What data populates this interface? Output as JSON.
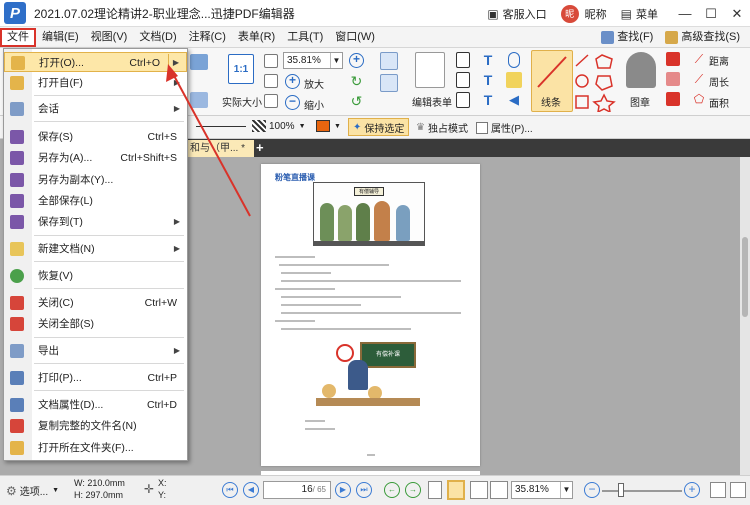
{
  "titlebar": {
    "logo_letter": "P",
    "title": "2021.07.02理论精讲2-职业理念...迅捷PDF编辑器",
    "feedback": "客服入口",
    "avatar_text": "昵",
    "nickname": "昵称",
    "menu": "菜单",
    "minimize": "—",
    "maximize": "☐",
    "close": "✕"
  },
  "menubar": {
    "items": [
      "文件",
      "编辑(E)",
      "视图(V)",
      "文档(D)",
      "注释(C)",
      "表单(R)",
      "工具(T)",
      "窗口(W)"
    ],
    "find": "查找(F)",
    "advanced_find": "高级查找(S)"
  },
  "ribbon": {
    "actual_size_glyph": "1:1",
    "actual_size": "实际大小",
    "zoom_value": "35.81%",
    "zoom_in": "放大",
    "zoom_out": "缩小",
    "edit_form": "编辑表单",
    "line": "线条",
    "stamp": "图章",
    "distance": "距离",
    "perimeter": "周长",
    "area": "面积"
  },
  "toolbar2": {
    "zoom": "100%",
    "keep_selected": "保持选定",
    "exclusive_mode": "独占模式",
    "properties": "属性(P)..."
  },
  "tabbar": {
    "tab_label": "和与（甲... *",
    "plus": "+"
  },
  "page": {
    "logo": "粉笔直播课",
    "sign1": "有偿辅导",
    "sign2": "有偿补课"
  },
  "file_menu": {
    "items": [
      {
        "label": "打开(O)...",
        "shortcut": "Ctrl+O",
        "submenu": true,
        "highlight": true
      },
      {
        "label": "打开自(F)",
        "shortcut": "",
        "submenu": true
      },
      {
        "label": "会话",
        "shortcut": "",
        "submenu": true
      },
      {
        "label": "保存(S)",
        "shortcut": "Ctrl+S",
        "submenu": false
      },
      {
        "label": "另存为(A)...",
        "shortcut": "Ctrl+Shift+S",
        "submenu": false
      },
      {
        "label": "另存为副本(Y)...",
        "shortcut": "",
        "submenu": false
      },
      {
        "label": "全部保存(L)",
        "shortcut": "",
        "submenu": false
      },
      {
        "label": "保存到(T)",
        "shortcut": "",
        "submenu": true
      },
      {
        "label": "新建文档(N)",
        "shortcut": "",
        "submenu": true
      },
      {
        "label": "恢复(V)",
        "shortcut": "",
        "submenu": false
      },
      {
        "label": "关闭(C)",
        "shortcut": "Ctrl+W",
        "submenu": false
      },
      {
        "label": "关闭全部(S)",
        "shortcut": "",
        "submenu": false
      },
      {
        "label": "导出",
        "shortcut": "",
        "submenu": true
      },
      {
        "label": "打印(P)...",
        "shortcut": "Ctrl+P",
        "submenu": false
      },
      {
        "label": "文档属性(D)...",
        "shortcut": "Ctrl+D",
        "submenu": false
      },
      {
        "label": "复制完整的文件名(N)",
        "shortcut": "",
        "submenu": false
      },
      {
        "label": "打开所在文件夹(F)...",
        "shortcut": "",
        "submenu": false
      }
    ]
  },
  "statusbar": {
    "options": "选项...",
    "width": "W: 210.0mm",
    "height": "H: 297.0mm",
    "x": "X:",
    "y": "Y:",
    "page": "16",
    "total": "/ 65",
    "zoom": "35.81%"
  },
  "colors": {
    "highlight": "#fde7a8",
    "accent_red": "#d9332a",
    "accent_blue": "#2b6cc4"
  }
}
